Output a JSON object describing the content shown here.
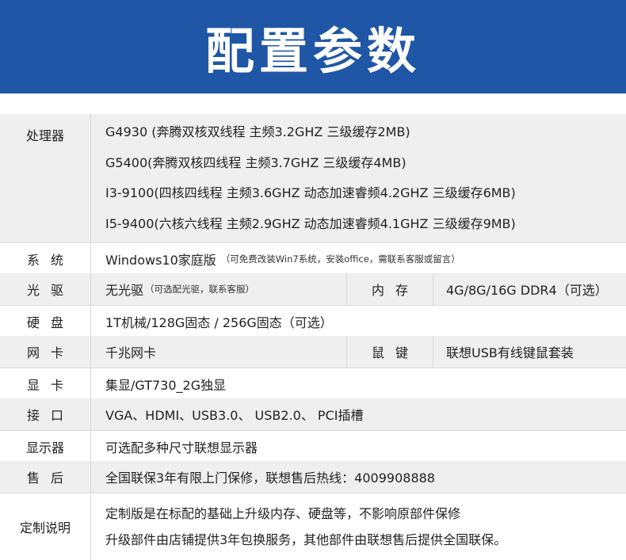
{
  "banner": {
    "title": "配置参数"
  },
  "cpu": {
    "label": "处理器",
    "options": [
      "G4930 (奔腾双核双线程  主频3.2GHZ   三级缓存2MB)",
      "G5400(奔腾双核四线程   主频3.7GHZ   三级缓存4MB)",
      "I3-9100(四核四线程   主频3.6GHZ   动态加速睿频4.2GHZ   三级缓存6MB)",
      "I5-9400(六核六线程   主频2.9GHZ   动态加速睿频4.1GHZ   三级缓存9MB)"
    ]
  },
  "os": {
    "label": "系统",
    "value": "Windows10家庭版",
    "note": "（可免费改装Win7系统，安装office，需联系客服或留言）"
  },
  "optical": {
    "label": "光驱",
    "value": "无光驱",
    "note": "（可选配光驱，联系客服）"
  },
  "memory": {
    "label": "内存",
    "value": "4G/8G/16G  DDR4（可选）"
  },
  "disk": {
    "label": "硬盘",
    "value": "1T机械/128G固态 / 256G固态（可选）"
  },
  "network": {
    "label": "网卡",
    "value": "千兆网卡"
  },
  "mouse": {
    "label": "鼠键",
    "value": "联想USB有线键鼠套装"
  },
  "graphics": {
    "label": "显卡",
    "value": "集显/GT730_2G独显"
  },
  "ports": {
    "label": "接口",
    "value": "VGA、HDMI、USB3.0、  USB2.0、 PCI插槽"
  },
  "monitor": {
    "label": "显示器",
    "value": "可选配多种尺寸联想显示器"
  },
  "service": {
    "label": "售后",
    "value": "全国联保3年有限上门保修，联想售后热线：4009908888"
  },
  "custom": {
    "label": "定制说明",
    "lines": [
      "定制版是在标配的基础上升级内存、硬盘等，不影响原部件保修",
      "升级部件由店铺提供3年包换服务，其他部件由联想售后提供全国联保。"
    ]
  }
}
